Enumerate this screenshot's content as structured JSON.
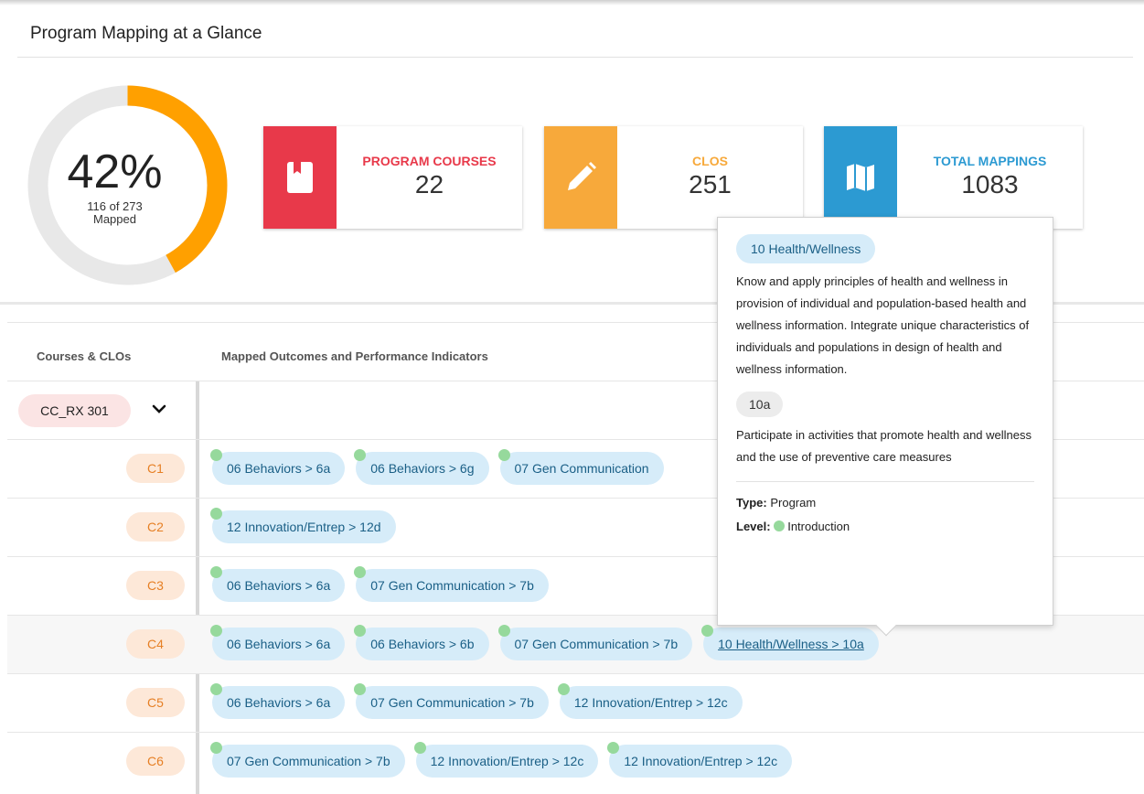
{
  "header": {
    "title": "Program Mapping at a Glance"
  },
  "summary": {
    "percent": "42%",
    "mapped_line1": "116 of 273",
    "mapped_line2": "Mapped",
    "progress_fraction": 0.42,
    "colors": {
      "progress": "#ffa000",
      "track": "#e8e8e8"
    }
  },
  "cards": [
    {
      "label": "PROGRAM COURSES",
      "value": "22",
      "icon": "book-icon",
      "color": "#e8394a"
    },
    {
      "label": "CLOS",
      "value": "251",
      "icon": "pencil-icon",
      "color": "#f7a93b"
    },
    {
      "label": "TOTAL MAPPINGS",
      "value": "1083",
      "icon": "map-icon",
      "color": "#2c9ad2"
    }
  ],
  "table": {
    "col1": "Courses & CLOs",
    "col2": "Mapped Outcomes and Performance Indicators",
    "course": "CC_RX 301",
    "rows": [
      {
        "clo": "C1",
        "tags": [
          "06 Behaviors > 6a",
          "06 Behaviors > 6g",
          "07 Gen Communication"
        ]
      },
      {
        "clo": "C2",
        "tags": [
          "12 Innovation/Entrep > 12d"
        ]
      },
      {
        "clo": "C3",
        "tags": [
          "06 Behaviors > 6a",
          "07 Gen Communication > 7b"
        ]
      },
      {
        "clo": "C4",
        "tags": [
          "06 Behaviors > 6a",
          "06 Behaviors > 6b",
          "07 Gen Communication > 7b",
          "10 Health/Wellness > 10a"
        ]
      },
      {
        "clo": "C5",
        "tags": [
          "06 Behaviors > 6a",
          "07 Gen Communication > 7b",
          "12 Innovation/Entrep > 12c"
        ]
      },
      {
        "clo": "C6",
        "tags": [
          "07 Gen Communication > 7b",
          "12 Innovation/Entrep > 12c",
          "12 Innovation/Entrep > 12c"
        ]
      }
    ]
  },
  "tooltip": {
    "outcome": "10 Health/Wellness",
    "outcome_desc": "Know and apply principles of health and wellness in provision of individual and population-based health and wellness information. Integrate unique characteristics of individuals and populations in design of health and wellness information.",
    "indicator": "10a",
    "indicator_desc": "Participate in activities that promote health and wellness and the use of preventive care measures",
    "type_label": "Type:",
    "type_value": "Program",
    "level_label": "Level:",
    "level_value": "Introduction"
  }
}
